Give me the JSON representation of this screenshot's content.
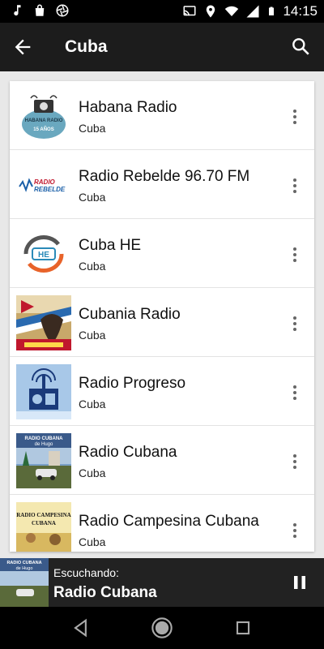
{
  "status_bar": {
    "time": "14:15",
    "left_icons": [
      "music-note-icon",
      "bag-icon",
      "shutter-icon"
    ],
    "right_icons": [
      "cast-icon",
      "location-icon",
      "wifi-icon",
      "signal-icon",
      "battery-icon"
    ]
  },
  "app_bar": {
    "title": "Cuba",
    "back_icon": "arrow-back-icon",
    "search_icon": "search-icon"
  },
  "stations": [
    {
      "name": "Habana Radio",
      "country": "Cuba"
    },
    {
      "name": "Radio Rebelde 96.70 FM",
      "country": "Cuba"
    },
    {
      "name": "Cuba HE",
      "country": "Cuba"
    },
    {
      "name": "Cubania Radio",
      "country": "Cuba"
    },
    {
      "name": "Radio Progreso",
      "country": "Cuba"
    },
    {
      "name": "Radio Cubana",
      "country": "Cuba"
    },
    {
      "name": "Radio Campesina Cubana",
      "country": "Cuba"
    }
  ],
  "logos": {
    "habana_text": "HABANA RADIO",
    "habana_years": "15 AÑOS",
    "rebelde_text_1": "RADIO",
    "rebelde_text_2": "REBELDE",
    "cubana_text_1": "RADIO CUBANA",
    "cubana_text_2": "de Hugo",
    "campesina_text_1": "RADIO CAMPESINA",
    "campesina_text_2": "CUBANA"
  },
  "player": {
    "label": "Escuchando:",
    "station": "Radio Cubana",
    "state_icon": "pause-icon"
  },
  "nav_bar": {
    "icons": [
      "back-triangle-icon",
      "home-circle-icon",
      "recents-square-icon"
    ]
  },
  "colors": {
    "app_bar": "#1c1c1c",
    "status_bar": "#000000",
    "player": "#222222",
    "background": "#e8e8e8"
  }
}
